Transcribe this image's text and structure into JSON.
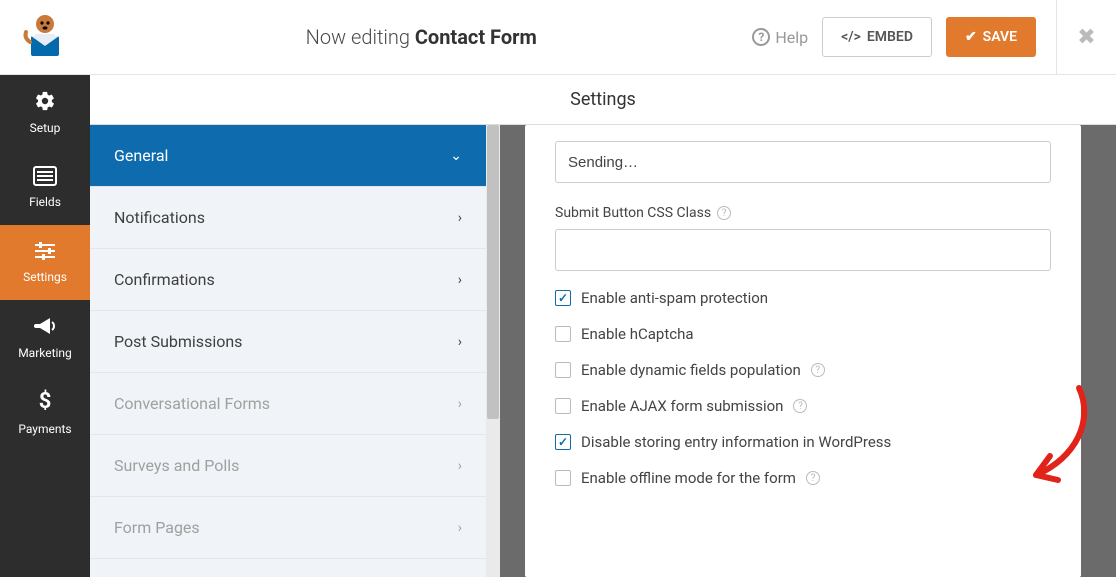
{
  "topbar": {
    "editing_prefix": "Now editing ",
    "form_name": "Contact Form",
    "help_label": "Help",
    "embed_label": "EMBED",
    "save_label": "SAVE"
  },
  "sidebar": {
    "items": [
      {
        "label": "Setup",
        "icon": "gear"
      },
      {
        "label": "Fields",
        "icon": "list"
      },
      {
        "label": "Settings",
        "icon": "sliders"
      },
      {
        "label": "Marketing",
        "icon": "horn"
      },
      {
        "label": "Payments",
        "icon": "dollar"
      }
    ]
  },
  "settings": {
    "header": "Settings",
    "menu": [
      {
        "label": "General",
        "active": true
      },
      {
        "label": "Notifications"
      },
      {
        "label": "Confirmations"
      },
      {
        "label": "Post Submissions"
      },
      {
        "label": "Conversational Forms",
        "disabled": true
      },
      {
        "label": "Surveys and Polls",
        "disabled": true
      },
      {
        "label": "Form Pages",
        "disabled": true
      }
    ]
  },
  "form": {
    "sending_value": "Sending…",
    "css_class_label": "Submit Button CSS Class",
    "css_class_value": "",
    "checkboxes": [
      {
        "label": "Enable anti-spam protection",
        "checked": true,
        "help": false
      },
      {
        "label": "Enable hCaptcha",
        "checked": false,
        "help": false
      },
      {
        "label": "Enable dynamic fields population",
        "checked": false,
        "help": true
      },
      {
        "label": "Enable AJAX form submission",
        "checked": false,
        "help": true
      },
      {
        "label": "Disable storing entry information in WordPress",
        "checked": true,
        "help": false
      },
      {
        "label": "Enable offline mode for the form",
        "checked": false,
        "help": true
      }
    ]
  }
}
